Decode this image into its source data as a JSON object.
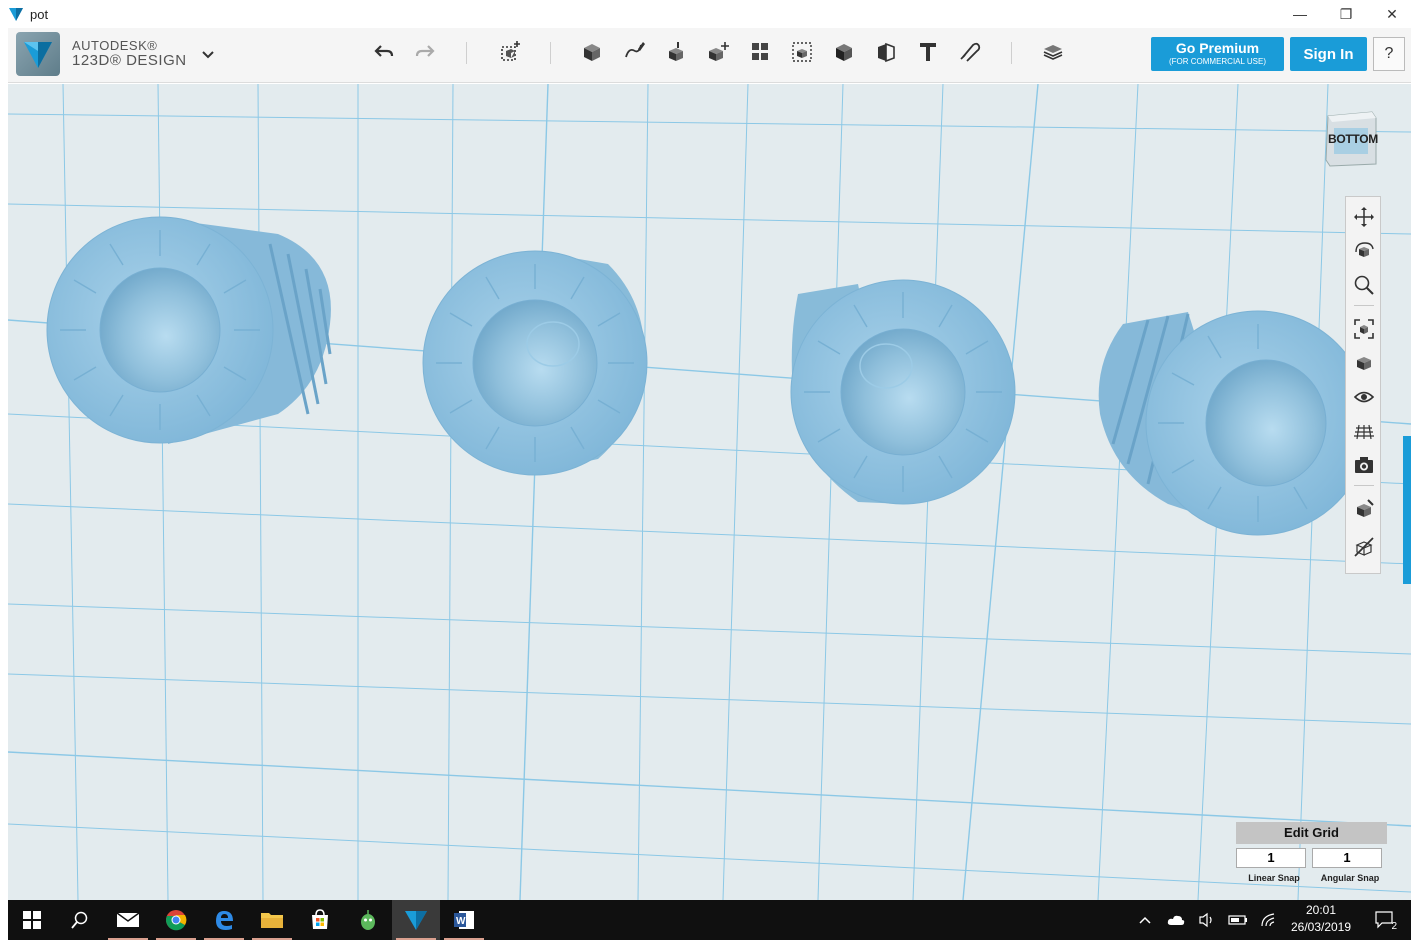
{
  "window": {
    "title": "pot",
    "controls": {
      "minimize": "—",
      "restore": "❐",
      "close": "✕"
    }
  },
  "app": {
    "brand_line1": "AUTODESK®",
    "brand_line2": "123D® DESIGN"
  },
  "toolbar": {
    "tools": [
      "undo-icon",
      "redo-icon",
      "primitives-icon",
      "sketch-icon",
      "construct-icon",
      "modify-icon",
      "pattern-icon",
      "grouping-icon",
      "combine-icon",
      "measure-icon",
      "text-icon",
      "snap-icon",
      "material-icon"
    ],
    "go_premium_label": "Go Premium",
    "go_premium_sub": "(FOR COMMERCIAL USE)",
    "sign_in_label": "Sign In",
    "help_label": "?"
  },
  "viewcube": {
    "face": "BOTTOM"
  },
  "navbar": {
    "tools": [
      "pan-icon",
      "orbit-icon",
      "zoom-icon",
      "fit-icon",
      "view-icon",
      "visibility-icon",
      "grid-icon",
      "camera-icon",
      "material-display-icon",
      "hide-icon"
    ]
  },
  "edit_grid": {
    "header": "Edit Grid",
    "linear_snap_value": "1",
    "angular_snap_value": "1",
    "linear_snap_label": "Linear Snap",
    "angular_snap_label": "Angular Snap"
  },
  "taskbar": {
    "apps": [
      "start-icon",
      "search-icon",
      "mail-icon",
      "chrome-icon",
      "edge-icon",
      "file-explorer-icon",
      "store-icon",
      "android-icon",
      "123d-design-icon",
      "word-icon"
    ],
    "clock_time": "20:01",
    "clock_date": "26/03/2019",
    "notifications_count": "2"
  },
  "colors": {
    "accent": "#1a9cd8",
    "viewport_bg": "#e3ebee",
    "model_fill": "#8fc0dc",
    "grid_line": "#8cc8e6"
  }
}
